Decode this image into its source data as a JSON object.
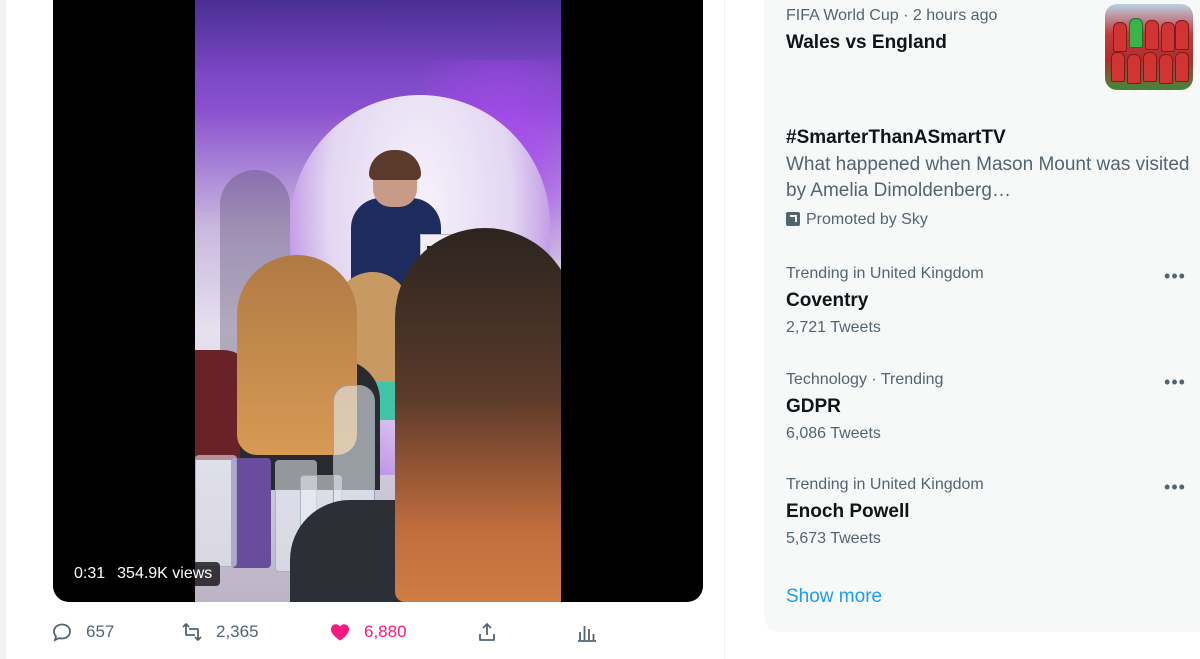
{
  "video": {
    "duration": "0:31",
    "views": "354.9K views"
  },
  "actions": {
    "replies": "657",
    "retweets": "2,365",
    "likes": "6,880"
  },
  "trends": {
    "items": [
      {
        "meta": "FIFA World Cup · 2 hours ago",
        "title": "Wales vs England",
        "thumbnail": "team-photo"
      },
      {
        "title": "#SmarterThanASmartTV",
        "description": "What happened when Mason Mount was visited by Amelia Dimoldenberg…",
        "promoted": "Promoted by Sky"
      },
      {
        "meta": "Trending in United Kingdom",
        "title": "Coventry",
        "count": "2,721 Tweets"
      },
      {
        "meta": "Technology · Trending",
        "title": "GDPR",
        "count": "6,086 Tweets"
      },
      {
        "meta": "Trending in United Kingdom",
        "title": "Enoch Powell",
        "count": "5,673 Tweets"
      }
    ],
    "show_more": "Show more"
  },
  "colors": {
    "accent": "#1d9bf0",
    "like": "#f91880",
    "muted": "#536471",
    "panel": "#f7f9f9"
  },
  "icons": [
    "reply-icon",
    "retweet-icon",
    "like-icon",
    "share-icon",
    "analytics-icon",
    "more-icon",
    "promoted-icon"
  ]
}
